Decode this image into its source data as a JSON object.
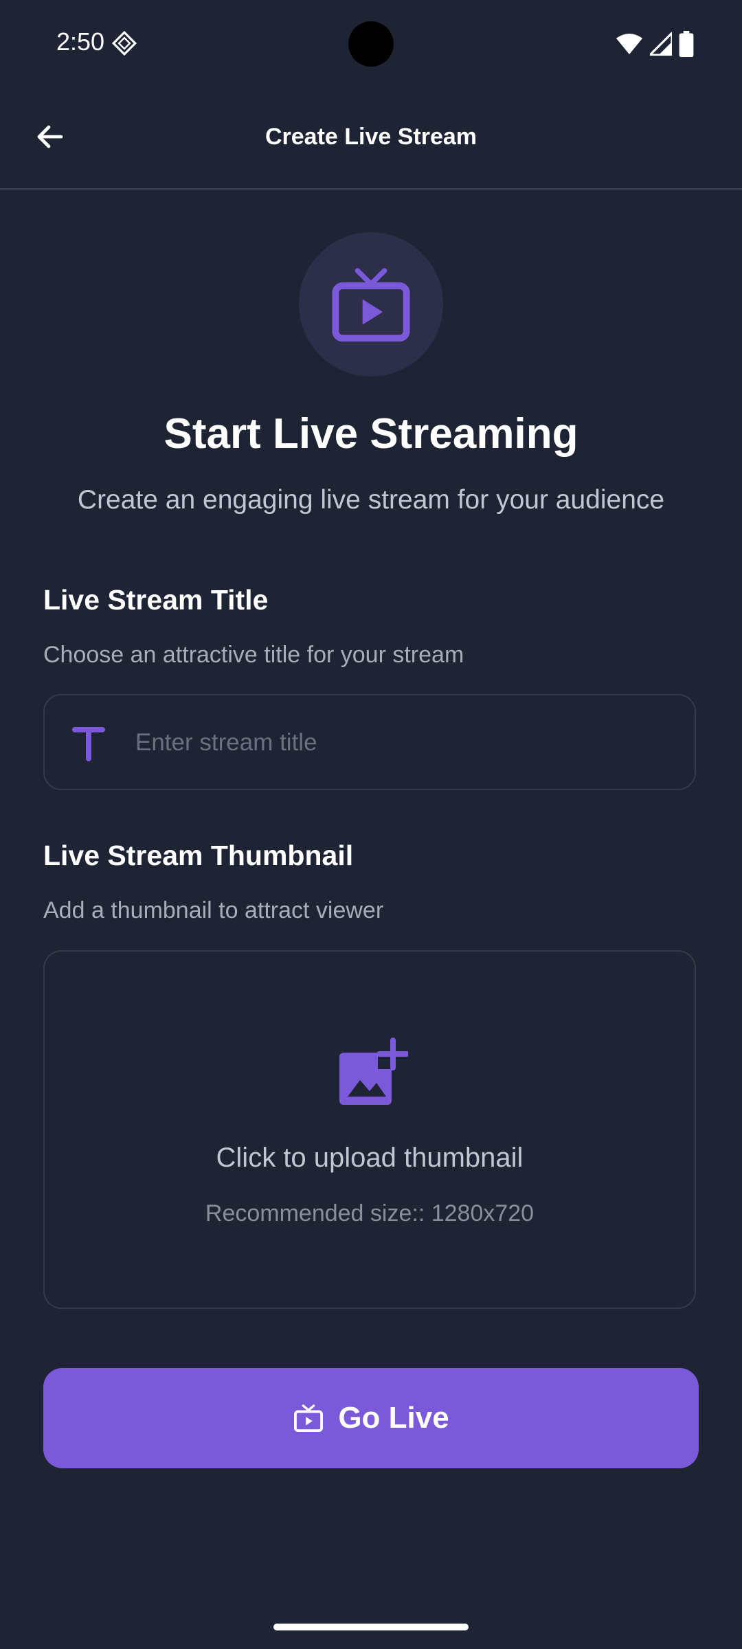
{
  "status_bar": {
    "time": "2:50"
  },
  "app_bar": {
    "title": "Create Live Stream"
  },
  "hero": {
    "title": "Start Live Streaming",
    "subtitle": "Create an engaging live stream for your audience"
  },
  "title_section": {
    "label": "Live Stream Title",
    "hint": "Choose an attractive title for your stream",
    "input_placeholder": "Enter stream title",
    "input_value": ""
  },
  "thumbnail_section": {
    "label": "Live Stream Thumbnail",
    "hint": "Add a thumbnail to attract viewer",
    "upload_text": "Click to upload thumbnail",
    "upload_hint": "Recommended size:: 1280x720"
  },
  "go_live_button": {
    "label": "Go Live"
  },
  "colors": {
    "background": "#1e2433",
    "accent": "#7b5ad9",
    "hero_circle": "#2d2e4a",
    "border": "#353b4b"
  },
  "icons": {
    "back": "arrow-left-icon",
    "hero": "tv-play-icon",
    "title_field": "text-t-icon",
    "upload": "add-photo-icon",
    "go_live": "tv-play-icon"
  }
}
